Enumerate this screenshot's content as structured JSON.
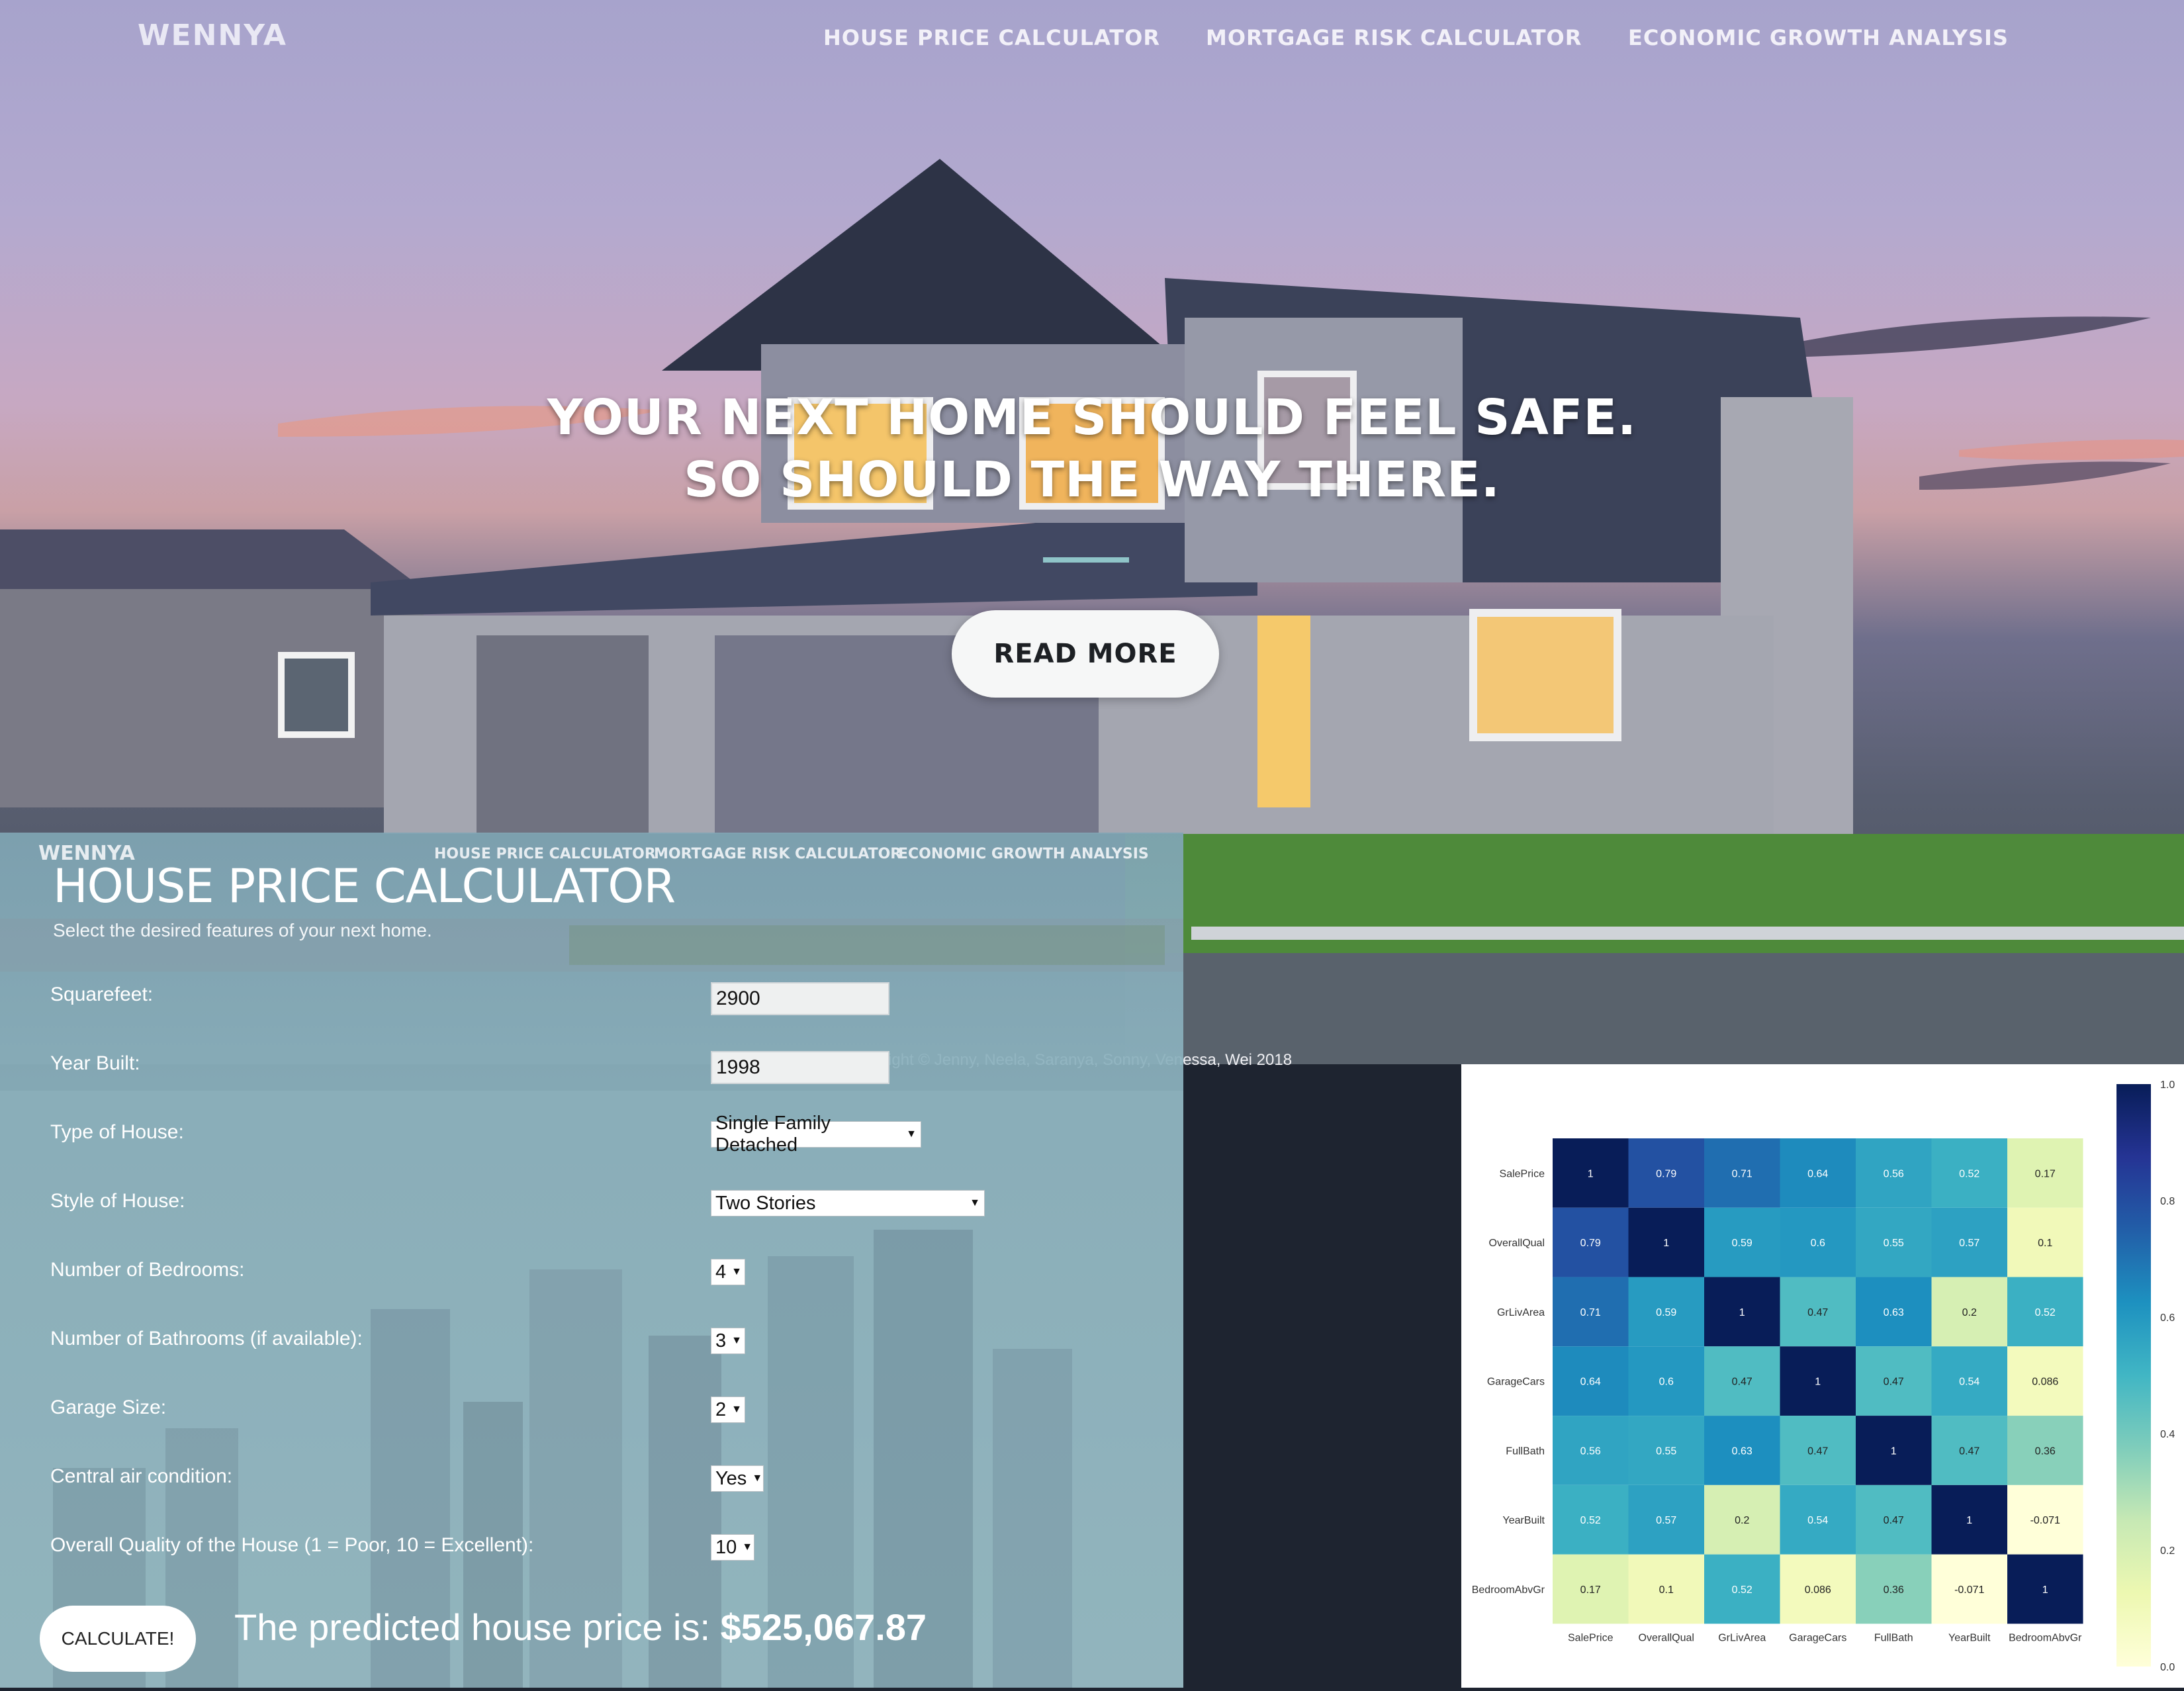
{
  "nav": {
    "brand": "WENNYA",
    "links": [
      "HOUSE PRICE CALCULATOR",
      "MORTGAGE RISK CALCULATOR",
      "ECONOMIC GROWTH ANALYSIS"
    ]
  },
  "hero": {
    "headline_line1": "YOUR NEXT HOME SHOULD FEEL SAFE.",
    "headline_line2": "SO SHOULD THE WAY THERE.",
    "button_label": "READ MORE"
  },
  "panel": {
    "brand": "WENNYA",
    "nav_links": [
      "HOUSE PRICE CALCULATOR",
      "MORTGAGE RISK CALCULATOR",
      "ECONOMIC GROWTH ANALYSIS"
    ],
    "title": "HOUSE PRICE CALCULATOR",
    "subtitle": "Select the desired features of your next home.",
    "fields": {
      "squarefeet": {
        "label": "Squarefeet:",
        "value": "2900"
      },
      "year_built": {
        "label": "Year Built:",
        "value": "1998"
      },
      "house_type": {
        "label": "Type of House:",
        "value": "Single Family Detached"
      },
      "house_style": {
        "label": "Style of House:",
        "value": "Two Stories"
      },
      "bedrooms": {
        "label": "Number of Bedrooms:",
        "value": "4"
      },
      "bathrooms": {
        "label": "Number of Bathrooms (if available):",
        "value": "3"
      },
      "garage": {
        "label": "Garage Size:",
        "value": "2"
      },
      "central_air": {
        "label": "Central air condition:",
        "value": "Yes"
      },
      "quality": {
        "label": "Overall Quality of the House (1 = Poor, 10 = Excellent):",
        "value": "10"
      }
    },
    "calculate_label": "CALCULATE!",
    "result_prefix": "The predicted house price is: ",
    "result_value": "$525,067.87"
  },
  "footer": {
    "copyright": "Copyright © Jenny, Neela, Saranya, Sonny, Venessa, Wei 2018"
  },
  "chart_data": {
    "type": "heatmap",
    "labels": [
      "SalePrice",
      "OverallQual",
      "GrLivArea",
      "GarageCars",
      "FullBath",
      "YearBuilt",
      "BedroomAbvGr"
    ],
    "values": [
      [
        1,
        0.79,
        0.71,
        0.64,
        0.56,
        0.52,
        0.17
      ],
      [
        0.79,
        1,
        0.59,
        0.6,
        0.55,
        0.57,
        0.1
      ],
      [
        0.71,
        0.59,
        1,
        0.47,
        0.63,
        0.2,
        0.52
      ],
      [
        0.64,
        0.6,
        0.47,
        1,
        0.47,
        0.54,
        0.086
      ],
      [
        0.56,
        0.55,
        0.63,
        0.47,
        1,
        0.47,
        0.36
      ],
      [
        0.52,
        0.57,
        0.2,
        0.54,
        0.47,
        1,
        -0.071
      ],
      [
        0.17,
        0.1,
        0.52,
        0.086,
        0.36,
        -0.071,
        1
      ]
    ],
    "colorbar_ticks": [
      "1.0",
      "0.8",
      "0.6",
      "0.4",
      "0.2",
      "0.0"
    ],
    "colorbar_range": [
      0,
      1
    ],
    "colormap": "YlGnBu"
  }
}
